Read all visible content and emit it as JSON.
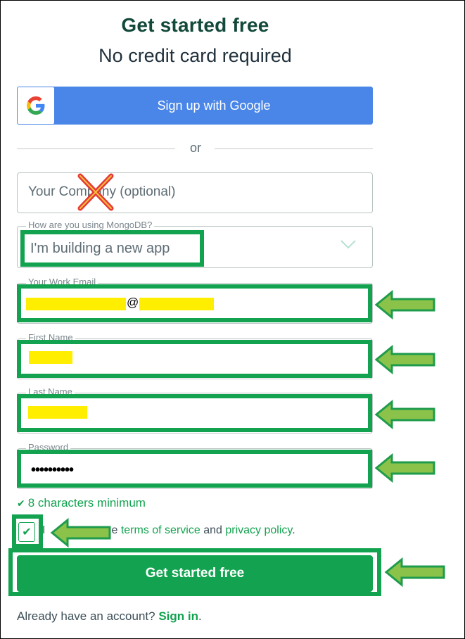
{
  "heading": {
    "title": "Get started free",
    "subtitle": "No credit card required"
  },
  "google_button": {
    "label": "Sign up with Google",
    "icon": "google-g-icon"
  },
  "divider": {
    "text": "or"
  },
  "fields": {
    "company": {
      "placeholder": "Your Company (optional)"
    },
    "usage": {
      "label": "How are you using MongoDB?",
      "value": "I'm building a new app",
      "icon": "chevron-down-icon"
    },
    "email": {
      "label": "Your Work Email",
      "value_visible": "@"
    },
    "first_name": {
      "label": "First Name"
    },
    "last_name": {
      "label": "Last Name"
    },
    "password": {
      "label": "Password",
      "value_masked": "••••••••••"
    }
  },
  "password_hint": {
    "text": "8 characters minimum",
    "icon": "check-icon"
  },
  "terms": {
    "checked": true,
    "prefix": "I",
    "suffix": "e",
    "tos_link": "terms of service",
    "and_text": "and",
    "privacy_link": "privacy policy",
    "period": "."
  },
  "submit_button": {
    "label": "Get started free"
  },
  "signin": {
    "prompt": "Already have an account?",
    "link": "Sign in",
    "period": "."
  },
  "annotations": {
    "highlight_color": "#13a350",
    "arrow_color": "#8bc34a",
    "redaction_color": "#ffee00",
    "cross_color": "#e53935"
  }
}
